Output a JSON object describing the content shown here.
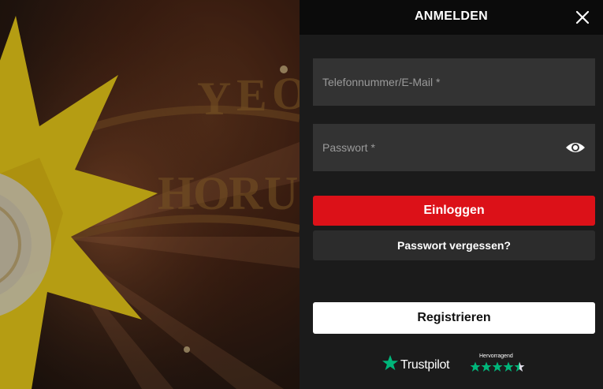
{
  "dialog": {
    "title": "ANMELDEN",
    "close_icon": "close-icon"
  },
  "form": {
    "login_field": {
      "placeholder": "Telefonnummer/E-Mail *",
      "value": ""
    },
    "password_field": {
      "placeholder": "Passwort *",
      "value": "",
      "toggle_icon": "eye-icon"
    },
    "login_button": "Einloggen",
    "forgot_button": "Passwort vergessen?",
    "register_button": "Registrieren"
  },
  "trustpilot": {
    "brand": "Trustpilot",
    "rating_label": "Hervorragend",
    "stars": 4.5
  },
  "colors": {
    "accent": "#dc1118",
    "trustpilot_green": "#00b67a",
    "panel_bg": "#1b1b1b",
    "field_bg": "#333333"
  }
}
